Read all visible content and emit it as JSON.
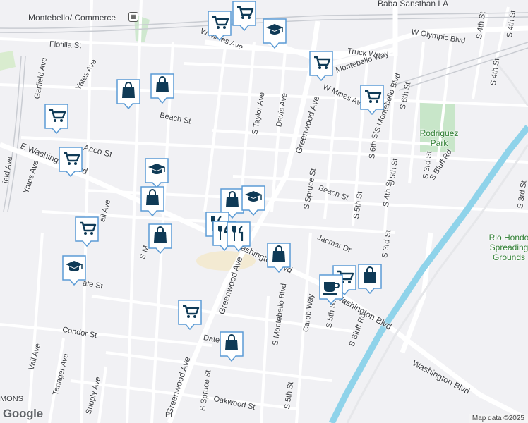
{
  "labels": {
    "montebello_commerce": "Montebello/ Commerce",
    "baba_sansthan": "Baba Sansthan LA",
    "flotilla": "Flotilla St",
    "yates_ave_top": "Yates Ave",
    "garfield": "Garfield Ave",
    "w_mines_top": "W Mines Ave",
    "w_olympic": "W Olympic Blvd",
    "truck_way": "Truck Way",
    "montebello_way": "Montebello Way",
    "w_mines_mid": "W Mines Ave",
    "montebello_blvd_ne": "S Montebello Blvd",
    "s_6th_a": "S 6th St",
    "s_6th_b": "S 6th St",
    "s_4th_top": "S 4th St",
    "s_4th_top2": "S 4th St",
    "rodriguez": "Rodriguez Park",
    "beach_w": "Beach St",
    "s_taylor": "S Taylor Ave",
    "davis": "Davis Ave",
    "greenwood_n": "Greenwood Ave",
    "s_5th_a": "S 5th St",
    "s_3rd_a": "S 3rd St",
    "s_bluff_n": "S Bluff Rd",
    "acco": "Acco St",
    "e_washington": "E Washington Blvd",
    "ield_ave": "ield Ave",
    "yates_ave_low": "Yates Ave",
    "s_spruce_n": "S Spruce St",
    "beach_e": "Beach St",
    "s_4th_mid": "S 4th St",
    "s_5th_b": "S 5th St",
    "all_ave": "all Ave",
    "rio_hondo": "Rio Hondo Spreading Grounds",
    "jacmar": "Jacmar Dr",
    "s_3rd_b": "S 3rd St",
    "s_m": "S M",
    "washington_mid": "Washington Blvd",
    "greenwood_s": "Greenwood Ave",
    "s_montebello_blvd": "S Montebello Blvd",
    "carob": "Carob Way",
    "ate_st": "ate St",
    "washington_e": "Washington Blvd",
    "s_5th_c": "S 5th St",
    "s_bluff_s": "S Bluff Rd",
    "condor": "Condor St",
    "vail": "Vail Ave",
    "tanager": "Tanager Ave",
    "date": "Date",
    "supply": "Supply Ave",
    "greenwood_sw": "Greenwood Ave",
    "s_spruce_s": "S Spruce St",
    "oakwood": "Oakwood St",
    "s_5th_d": "S 5th St",
    "washington_se": "Washington Blvd",
    "el": "El",
    "mons": "MONS",
    "s_3rd_edge": "S 3rd St",
    "s_4th_edge": "S 4th St"
  },
  "pins": [
    {
      "type": "shopping-cart",
      "name": "grocery"
    },
    {
      "type": "shopping-cart",
      "name": "grocery"
    },
    {
      "type": "school",
      "name": "school"
    },
    {
      "type": "shopping-cart",
      "name": "grocery"
    },
    {
      "type": "shopping-cart",
      "name": "grocery"
    },
    {
      "type": "shopping-bag",
      "name": "shop"
    },
    {
      "type": "shopping-bag",
      "name": "shop"
    },
    {
      "type": "shopping-cart",
      "name": "grocery"
    },
    {
      "type": "shopping-cart",
      "name": "grocery"
    },
    {
      "type": "school",
      "name": "school"
    },
    {
      "type": "shopping-bag",
      "name": "shop"
    },
    {
      "type": "shopping-bag",
      "name": "shop"
    },
    {
      "type": "school",
      "name": "school"
    },
    {
      "type": "restaurant",
      "name": "restaurant"
    },
    {
      "type": "restaurant",
      "name": "restaurant"
    },
    {
      "type": "restaurant",
      "name": "restaurant"
    },
    {
      "type": "shopping-cart",
      "name": "grocery"
    },
    {
      "type": "shopping-bag",
      "name": "shop"
    },
    {
      "type": "shopping-bag",
      "name": "shop"
    },
    {
      "type": "school",
      "name": "school"
    },
    {
      "type": "shopping-cart",
      "name": "grocery"
    },
    {
      "type": "shopping-bag",
      "name": "shop"
    },
    {
      "type": "cafe",
      "name": "cafe"
    },
    {
      "type": "shopping-cart",
      "name": "grocery"
    },
    {
      "type": "shopping-bag",
      "name": "shop"
    }
  ],
  "footer": {
    "logo": "Google",
    "attribution": "Map data ©2025"
  },
  "colors": {
    "pin_fill": "#ffffff",
    "pin_border": "#5b9bd5",
    "icon": "#0f3a56",
    "river": "#8fd3ea",
    "park": "#c8e6c9"
  }
}
